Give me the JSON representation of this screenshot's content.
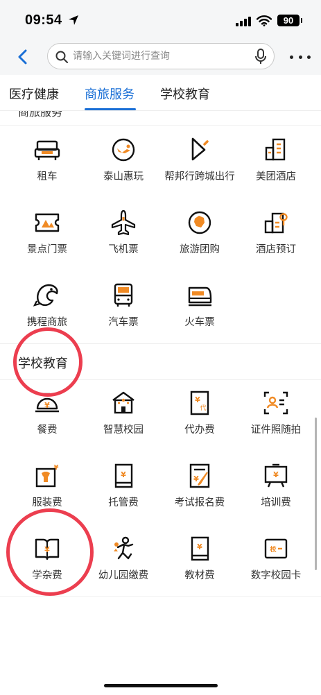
{
  "status_bar": {
    "time": "09:54",
    "battery": "90"
  },
  "search": {
    "placeholder": "请输入关键词进行查询"
  },
  "tabs": [
    {
      "label": "医疗健康",
      "active": false
    },
    {
      "label": "商旅服务",
      "active": true
    },
    {
      "label": "学校教育",
      "active": false
    }
  ],
  "travel": {
    "peek_title": "商旅服务",
    "items": [
      {
        "label": "租车",
        "icon": "car-rental-icon"
      },
      {
        "label": "泰山惠玩",
        "icon": "taishan-icon"
      },
      {
        "label": "帮邦行跨城出行",
        "icon": "bangbang-icon"
      },
      {
        "label": "美团酒店",
        "icon": "hotel-building-icon"
      },
      {
        "label": "景点门票",
        "icon": "ticket-icon"
      },
      {
        "label": "飞机票",
        "icon": "airplane-icon"
      },
      {
        "label": "旅游团购",
        "icon": "tour-group-icon"
      },
      {
        "label": "酒店预订",
        "icon": "hotel-booking-icon"
      },
      {
        "label": "携程商旅",
        "icon": "ctrip-dolphin-icon"
      },
      {
        "label": "汽车票",
        "icon": "bus-icon"
      },
      {
        "label": "火车票",
        "icon": "train-icon"
      }
    ]
  },
  "school": {
    "title": "学校教育",
    "items": [
      {
        "label": "餐费",
        "icon": "meal-bell-icon"
      },
      {
        "label": "智慧校园",
        "icon": "smart-campus-icon"
      },
      {
        "label": "代办费",
        "icon": "agency-fee-icon"
      },
      {
        "label": "证件照随拍",
        "icon": "id-photo-icon"
      },
      {
        "label": "服装费",
        "icon": "uniform-icon"
      },
      {
        "label": "托管费",
        "icon": "custody-fee-icon"
      },
      {
        "label": "考试报名费",
        "icon": "exam-fee-icon"
      },
      {
        "label": "培训费",
        "icon": "training-icon"
      },
      {
        "label": "学杂费",
        "icon": "tuition-book-icon"
      },
      {
        "label": "幼儿园缴费",
        "icon": "kindergarten-icon"
      },
      {
        "label": "教材费",
        "icon": "textbook-icon"
      },
      {
        "label": "数字校园卡",
        "icon": "campus-card-icon"
      }
    ]
  },
  "colors": {
    "accent": "#1a6fd6",
    "icon_orange": "#f08a24",
    "highlight_circle": "#ec3e4f"
  }
}
